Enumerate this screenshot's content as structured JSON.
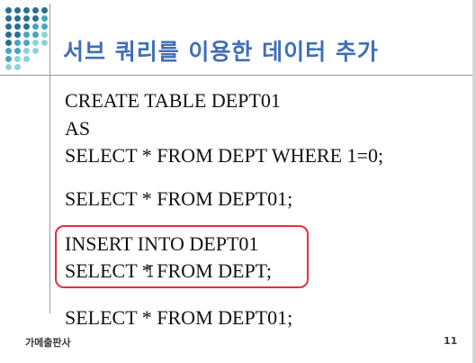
{
  "slide": {
    "title": "서브 쿼리를 이용한 데이터 추가",
    "code_lines": [
      "CREATE TABLE DEPT01",
      "AS",
      "SELECT * FROM DEPT WHERE 1=0;",
      "SELECT * FROM DEPT01;",
      "INSERT INTO DEPT01",
      "SELECT * FROM DEPT;",
      "SELECT * FROM DEPT01;"
    ],
    "footer_left": "가메출판사",
    "page_number": "11"
  },
  "colors": {
    "title": "#3f6fb6",
    "highlight_border": "#e8303a",
    "dot_dark": "#2a6f8f",
    "dot_mid": "#4aa3c3",
    "dot_light": "#8fd3d8"
  },
  "icons": {
    "decoration": "dot-grid",
    "cursor": "text-cursor-icon"
  }
}
